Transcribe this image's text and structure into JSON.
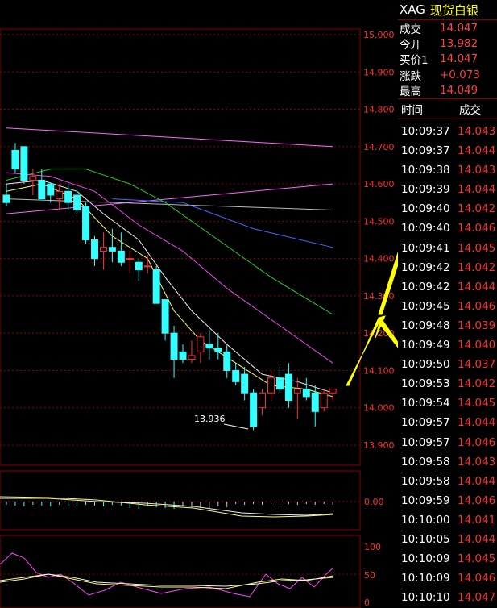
{
  "colors": {
    "background": "#000000",
    "border": "#8a0000",
    "grid": "#8a0000",
    "up_candle": "#ff3030",
    "down_candle": "#33ffff",
    "price_text": "#ff3030",
    "arrow": "#ffff00"
  },
  "quote": {
    "code": "XAG",
    "name": "现货白银",
    "rows": [
      {
        "label": "成交",
        "value": "14.047"
      },
      {
        "label": "今开",
        "value": "13.982"
      },
      {
        "label": "买价1",
        "value": "14.047"
      },
      {
        "label": "涨跌",
        "value": "+0.073"
      },
      {
        "label": "最高",
        "value": "14.049"
      }
    ]
  },
  "trades": {
    "header_time": "时间",
    "header_price": "成交",
    "rows": [
      {
        "time": "10:09:37",
        "price": "14.043"
      },
      {
        "time": "10:09:37",
        "price": "14.044"
      },
      {
        "time": "10:09:38",
        "price": "14.043"
      },
      {
        "time": "10:09:39",
        "price": "14.044"
      },
      {
        "time": "10:09:40",
        "price": "14.042"
      },
      {
        "time": "10:09:40",
        "price": "14.046"
      },
      {
        "time": "10:09:41",
        "price": "14.045"
      },
      {
        "time": "10:09:42",
        "price": "14.042"
      },
      {
        "time": "10:09:42",
        "price": "14.044"
      },
      {
        "time": "10:09:45",
        "price": "14.046"
      },
      {
        "time": "10:09:48",
        "price": "14.039"
      },
      {
        "time": "10:09:49",
        "price": "14.040"
      },
      {
        "time": "10:09:50",
        "price": "14.037"
      },
      {
        "time": "10:09:53",
        "price": "14.042"
      },
      {
        "time": "10:09:54",
        "price": "14.045"
      },
      {
        "time": "10:09:57",
        "price": "14.044"
      },
      {
        "time": "10:09:57",
        "price": "14.046"
      },
      {
        "time": "10:09:58",
        "price": "14.043"
      },
      {
        "time": "10:09:58",
        "price": "14.044"
      },
      {
        "time": "10:09:59",
        "price": "14.046"
      },
      {
        "time": "10:10:00",
        "price": "14.041"
      },
      {
        "time": "10:10:05",
        "price": "14.044"
      },
      {
        "time": "10:10:09",
        "price": "14.045"
      },
      {
        "time": "10:10:09",
        "price": "14.046"
      },
      {
        "time": "10:10:10",
        "price": "14.047"
      }
    ]
  },
  "chart_data": {
    "type": "candlestick",
    "ylim": [
      13.88,
      15.02
    ],
    "price_ticks": [
      "15.000",
      "14.900",
      "14.800",
      "14.700",
      "14.600",
      "14.500",
      "14.400",
      "14.300",
      "14.200",
      "14.100",
      "14.000",
      "13.900"
    ],
    "low_annotation": "13.936",
    "candles": [
      [
        14.57,
        14.6,
        14.54,
        14.55
      ],
      [
        14.69,
        14.71,
        14.63,
        14.64
      ],
      [
        14.7,
        14.7,
        14.6,
        14.61
      ],
      [
        14.61,
        14.64,
        14.57,
        14.62
      ],
      [
        14.61,
        14.64,
        14.58,
        14.56
      ],
      [
        14.6,
        14.6,
        14.55,
        14.57
      ],
      [
        14.56,
        14.6,
        14.53,
        14.58
      ],
      [
        14.58,
        14.6,
        14.53,
        14.55
      ],
      [
        14.57,
        14.59,
        14.52,
        14.53
      ],
      [
        14.54,
        14.55,
        14.44,
        14.45
      ],
      [
        14.45,
        14.46,
        14.38,
        14.4
      ],
      [
        14.42,
        14.47,
        14.37,
        14.43
      ],
      [
        14.43,
        14.48,
        14.39,
        14.42
      ],
      [
        14.42,
        14.47,
        14.38,
        14.39
      ],
      [
        14.4,
        14.42,
        14.36,
        14.4
      ],
      [
        14.39,
        14.4,
        14.34,
        14.37
      ],
      [
        14.38,
        14.41,
        14.36,
        14.38
      ],
      [
        14.37,
        14.38,
        14.28,
        14.28
      ],
      [
        14.29,
        14.29,
        14.18,
        14.2
      ],
      [
        14.2,
        14.22,
        14.08,
        14.13
      ],
      [
        14.15,
        14.17,
        14.12,
        14.13
      ],
      [
        14.13,
        14.18,
        14.12,
        14.14
      ],
      [
        14.15,
        14.2,
        14.12,
        14.19
      ],
      [
        14.17,
        14.21,
        14.13,
        14.16
      ],
      [
        14.16,
        14.2,
        14.13,
        14.15
      ],
      [
        14.15,
        14.17,
        14.08,
        14.1
      ],
      [
        14.1,
        14.12,
        14.06,
        14.07
      ],
      [
        14.09,
        14.11,
        14.02,
        14.04
      ],
      [
        14.04,
        14.05,
        13.94,
        13.95
      ],
      [
        14.0,
        14.05,
        13.98,
        14.04
      ],
      [
        14.04,
        14.1,
        14.02,
        14.08
      ],
      [
        14.08,
        14.11,
        14.04,
        14.05
      ],
      [
        14.09,
        14.12,
        14.0,
        14.02
      ],
      [
        14.04,
        14.08,
        13.97,
        14.05
      ],
      [
        14.05,
        14.08,
        14.02,
        14.03
      ],
      [
        14.04,
        14.06,
        13.95,
        13.99
      ],
      [
        14.0,
        14.05,
        13.99,
        14.04
      ],
      [
        14.04,
        14.05,
        14.02,
        14.05
      ]
    ],
    "lines": [
      {
        "name": "upper-channel",
        "color": "#ff66ff",
        "points": [
          [
            0,
            14.75
          ],
          [
            37,
            14.7
          ]
        ]
      },
      {
        "name": "lower-channel",
        "color": "#ff66ff",
        "points": [
          [
            0,
            14.52
          ],
          [
            37,
            14.6
          ]
        ]
      },
      {
        "name": "flat-line",
        "color": "#bbbbbb",
        "points": [
          [
            0,
            14.56
          ],
          [
            37,
            14.53
          ]
        ]
      },
      {
        "name": "ma-blue",
        "color": "#4466ff",
        "points": [
          [
            12,
            14.56
          ],
          [
            20,
            14.55
          ],
          [
            28,
            14.48
          ],
          [
            37,
            14.43
          ]
        ]
      },
      {
        "name": "ma-green",
        "color": "#22cc22",
        "points": [
          [
            0,
            14.61
          ],
          [
            5,
            14.64
          ],
          [
            9,
            14.64
          ],
          [
            14,
            14.6
          ],
          [
            18,
            14.55
          ],
          [
            24,
            14.45
          ],
          [
            30,
            14.35
          ],
          [
            37,
            14.25
          ]
        ]
      },
      {
        "name": "ma-magenta",
        "color": "#ee44ee",
        "points": [
          [
            0,
            14.63
          ],
          [
            5,
            14.62
          ],
          [
            10,
            14.58
          ],
          [
            15,
            14.49
          ],
          [
            20,
            14.42
          ],
          [
            25,
            14.32
          ],
          [
            31,
            14.22
          ],
          [
            37,
            14.12
          ]
        ]
      },
      {
        "name": "ma-yellow",
        "color": "#ffff66",
        "points": [
          [
            0,
            14.58
          ],
          [
            4,
            14.6
          ],
          [
            8,
            14.56
          ],
          [
            12,
            14.46
          ],
          [
            16,
            14.4
          ],
          [
            19,
            14.26
          ],
          [
            22,
            14.18
          ],
          [
            26,
            14.12
          ],
          [
            30,
            14.06
          ],
          [
            34,
            14.05
          ],
          [
            37,
            14.03
          ]
        ]
      },
      {
        "name": "ma-white",
        "color": "#eeeeee",
        "points": [
          [
            0,
            14.6
          ],
          [
            4,
            14.61
          ],
          [
            8,
            14.58
          ],
          [
            11,
            14.52
          ],
          [
            15,
            14.45
          ],
          [
            18,
            14.35
          ],
          [
            21,
            14.26
          ],
          [
            25,
            14.17
          ],
          [
            29,
            14.09
          ],
          [
            33,
            14.07
          ],
          [
            37,
            14.04
          ]
        ]
      }
    ],
    "macd": {
      "zero_label": "0.00"
    },
    "rsi": {
      "ticks": [
        "100",
        "50",
        "0"
      ]
    }
  }
}
